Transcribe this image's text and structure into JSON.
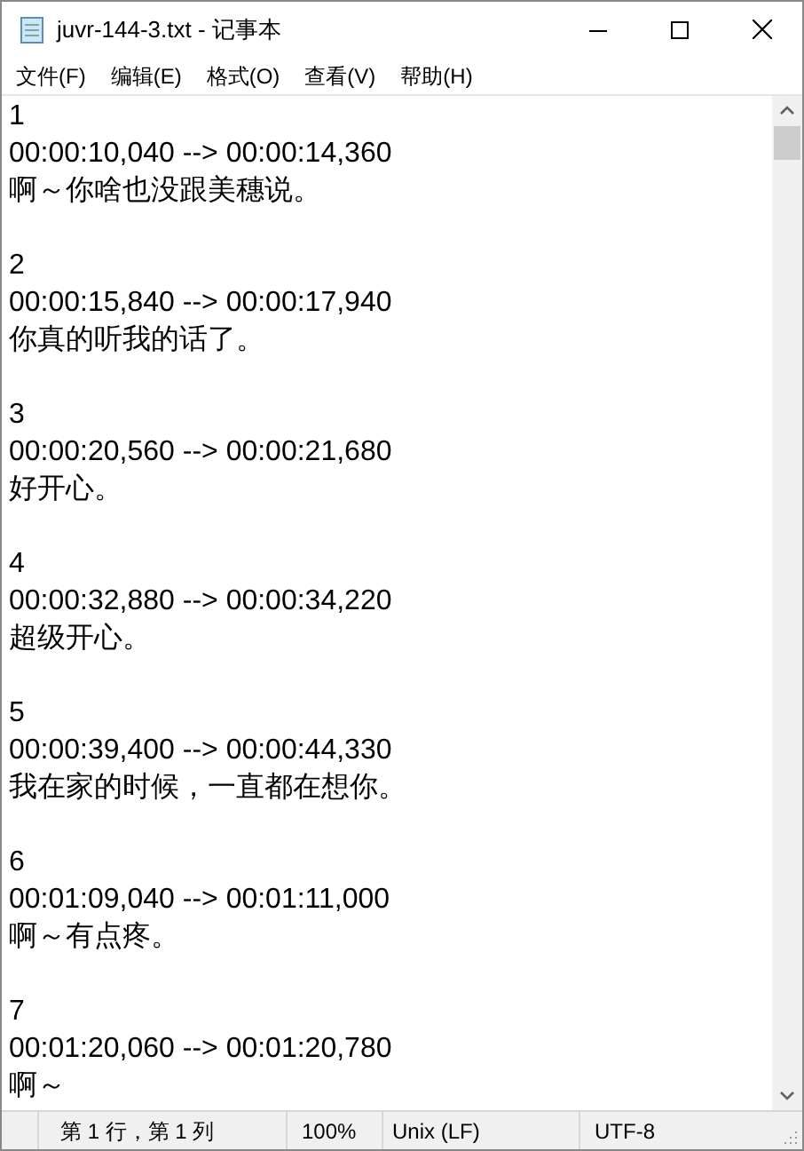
{
  "window": {
    "title": "juvr-144-3.txt - 记事本"
  },
  "menu": [
    "文件(F)",
    "编辑(E)",
    "格式(O)",
    "查看(V)",
    "帮助(H)"
  ],
  "subtitles": [
    {
      "index": "1",
      "timing": "00:00:10,040 --> 00:00:14,360",
      "text": "啊～你啥也没跟美穗说。"
    },
    {
      "index": "2",
      "timing": "00:00:15,840 --> 00:00:17,940",
      "text": "你真的听我的话了。"
    },
    {
      "index": "3",
      "timing": "00:00:20,560 --> 00:00:21,680",
      "text": "好开心。"
    },
    {
      "index": "4",
      "timing": "00:00:32,880 --> 00:00:34,220",
      "text": "超级开心。"
    },
    {
      "index": "5",
      "timing": "00:00:39,400 --> 00:00:44,330",
      "text": "我在家的时候，一直都在想你。"
    },
    {
      "index": "6",
      "timing": "00:01:09,040 --> 00:01:11,000",
      "text": "啊～有点疼。"
    },
    {
      "index": "7",
      "timing": "00:01:20,060 --> 00:01:20,780",
      "text": "啊～"
    }
  ],
  "status_bar": {
    "position": "第 1 行，第 1 列",
    "zoom": "100%",
    "line_ending": "Unix (LF)",
    "encoding": "UTF-8"
  }
}
